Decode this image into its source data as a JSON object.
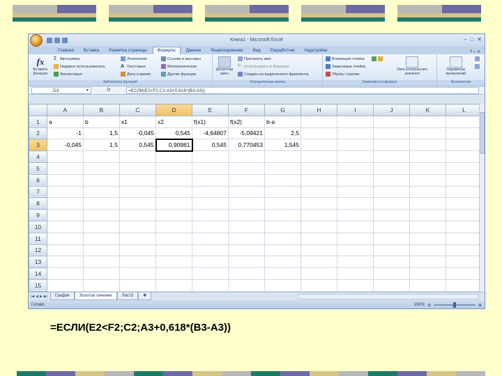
{
  "window": {
    "title": "Книга1 - Microsoft Excel"
  },
  "ribbon": {
    "tabs": [
      "Главная",
      "Вставка",
      "Разметка страницы",
      "Формулы",
      "Данные",
      "Рецензирование",
      "Вид",
      "Разработчик",
      "Надстройки"
    ],
    "active_tab": "Формулы",
    "groups": {
      "library": {
        "label": "Библиотека функций",
        "insert_function": "Вставить функцию",
        "autosum": "Автосумма",
        "recent": "Недавно использовались",
        "financial": "Финансовые",
        "logical": "Логические",
        "text": "Текстовые",
        "datetime": "Дата и время",
        "lookup": "Ссылки и массивы",
        "math": "Математические",
        "other": "Другие функции"
      },
      "names": {
        "label": "Определенные имена",
        "name_manager": "Диспетчер имен",
        "assign_name": "Присвоить имя",
        "use_in_formula": "Использовать в формуле",
        "create_from_selection": "Создать из выделенного фрагмента"
      },
      "audit": {
        "label": "Зависимости формул",
        "precedents": "Влияющие ячейки",
        "dependents": "Зависимые ячейки",
        "remove_arrows": "Убрать стрелки",
        "watch_window": "Окно контрольного значения"
      },
      "calc": {
        "label": "Вычисление",
        "options": "Параметры вычислений"
      }
    }
  },
  "formula_bar": {
    "name_box": "D3",
    "fx": "fx",
    "formula": "=ЕСЛИ(E2<F2;C2;A3+0,618*(B3-A3))"
  },
  "grid": {
    "columns": [
      "A",
      "B",
      "C",
      "D",
      "E",
      "F",
      "G",
      "H",
      "I",
      "J",
      "K",
      "L"
    ],
    "rows": [
      [
        "a",
        "b",
        "x1",
        "x2",
        "f(x1)",
        "f(x2)",
        "b-a",
        "",
        "",
        "",
        "",
        ""
      ],
      [
        "-1",
        "1,5",
        "-0,045",
        "0,545",
        "-4,64807",
        "-5,09421",
        "2,5",
        "",
        "",
        "",
        "",
        ""
      ],
      [
        "-0,045",
        "1,5",
        "0,545",
        "0,90981",
        "0,545",
        "0,770453",
        "1,545",
        "",
        "",
        "",
        "",
        ""
      ],
      [
        "",
        "",
        "",
        "",
        "",
        "",
        "",
        "",
        "",
        "",
        "",
        ""
      ],
      [
        "",
        "",
        "",
        "",
        "",
        "",
        "",
        "",
        "",
        "",
        "",
        ""
      ],
      [
        "",
        "",
        "",
        "",
        "",
        "",
        "",
        "",
        "",
        "",
        "",
        ""
      ],
      [
        "",
        "",
        "",
        "",
        "",
        "",
        "",
        "",
        "",
        "",
        "",
        ""
      ],
      [
        "",
        "",
        "",
        "",
        "",
        "",
        "",
        "",
        "",
        "",
        "",
        ""
      ],
      [
        "",
        "",
        "",
        "",
        "",
        "",
        "",
        "",
        "",
        "",
        "",
        ""
      ],
      [
        "",
        "",
        "",
        "",
        "",
        "",
        "",
        "",
        "",
        "",
        "",
        ""
      ],
      [
        "",
        "",
        "",
        "",
        "",
        "",
        "",
        "",
        "",
        "",
        "",
        ""
      ],
      [
        "",
        "",
        "",
        "",
        "",
        "",
        "",
        "",
        "",
        "",
        "",
        ""
      ],
      [
        "",
        "",
        "",
        "",
        "",
        "",
        "",
        "",
        "",
        "",
        "",
        ""
      ],
      [
        "",
        "",
        "",
        "",
        "",
        "",
        "",
        "",
        "",
        "",
        "",
        ""
      ],
      [
        "",
        "",
        "",
        "",
        "",
        "",
        "",
        "",
        "",
        "",
        "",
        ""
      ],
      [
        "",
        "",
        "",
        "",
        "",
        "",
        "",
        "",
        "",
        "",
        "",
        ""
      ]
    ],
    "active_cell": "D3"
  },
  "sheets": [
    "График",
    "Золотое сечение",
    "Лист3"
  ],
  "active_sheet": "Золотое сечение",
  "status": {
    "ready": "Готово",
    "zoom": "150%"
  },
  "caption": "=ЕСЛИ(E2<F2;C2;A3+0,618*(B3-A3))",
  "colors": {
    "background": "#ffffcc",
    "deco_green": "#1f7a68",
    "deco_purple": "#6b6aa6",
    "deco_tan": "#d6c486",
    "deco_gray": "#b8b8b8"
  }
}
